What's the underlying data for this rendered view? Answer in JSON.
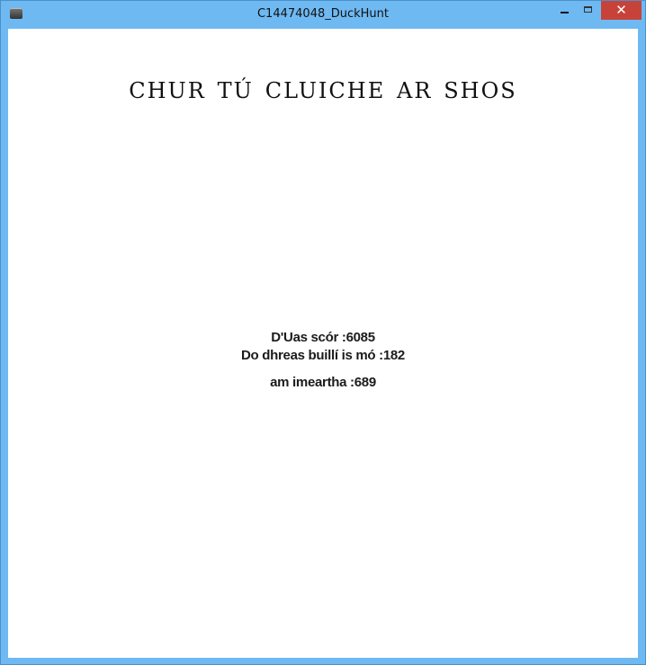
{
  "window": {
    "title": "C14474048_DuckHunt",
    "close_glyph": "✕"
  },
  "game_over": {
    "heading": "chur tú cluiche ar shos",
    "score_line": "D'Uas scór  :6085",
    "shots_line": "Do dhreas buillí is mó  :182",
    "time_line": "am imeartha  :689"
  }
}
